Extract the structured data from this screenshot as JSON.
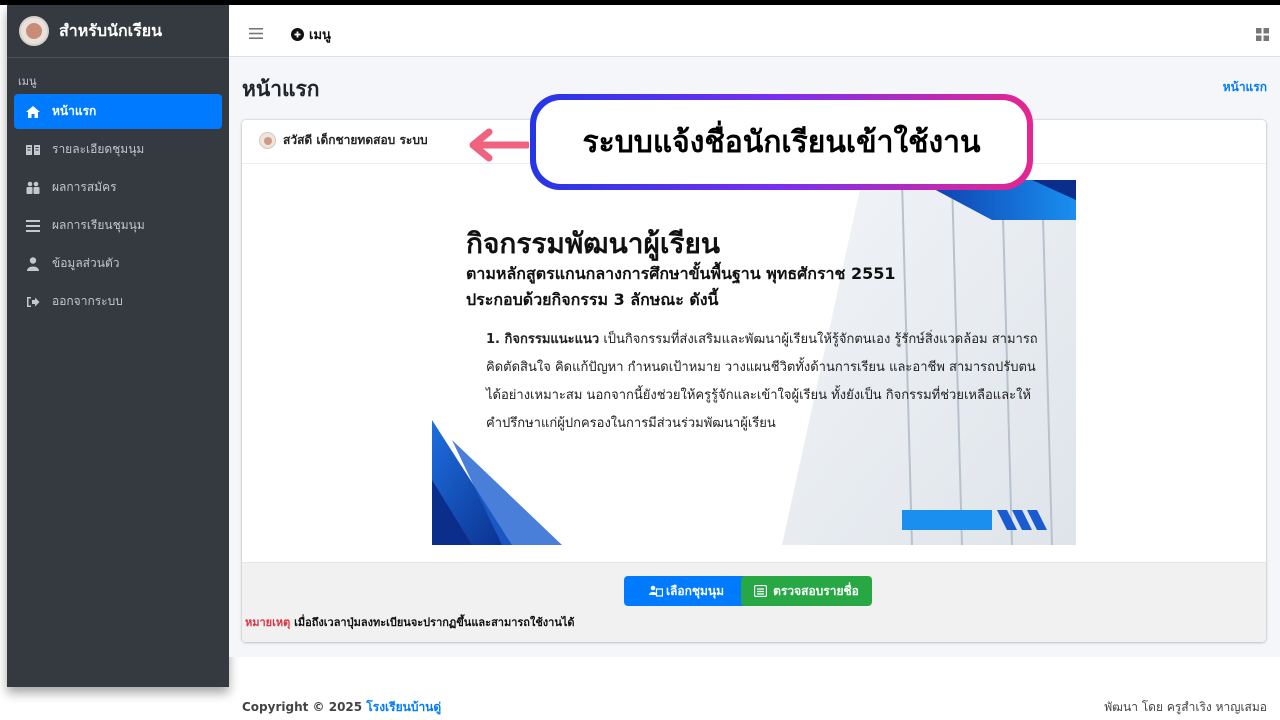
{
  "brand": {
    "title": "สำหรับนักเรียน"
  },
  "sidebar": {
    "header": "เมนู",
    "items": [
      {
        "label": "หน้าแรก",
        "icon": "home-icon",
        "active": true
      },
      {
        "label": "รายละเอียดชุมนุม",
        "icon": "book-open-icon",
        "active": false
      },
      {
        "label": "ผลการสมัคร",
        "icon": "users-icon",
        "active": false
      },
      {
        "label": "ผลการเรียนชุมนุม",
        "icon": "list-icon",
        "active": false
      },
      {
        "label": "ข้อมูลส่วนตัว",
        "icon": "user-icon",
        "active": false
      },
      {
        "label": "ออกจากระบบ",
        "icon": "sign-out-icon",
        "active": false
      }
    ]
  },
  "header": {
    "menu_label": "เมนู"
  },
  "content": {
    "page_title": "หน้าแรก",
    "breadcrumb": "หน้าแรก",
    "greeting": "สวัสดี เด็กชายทดสอบ ระบบ",
    "callout": "ระบบแจ้งชื่อนักเรียนเข้าใช้งาน",
    "banner": {
      "title": "กิจกรรมพัฒนาผู้เรียน",
      "subtitle1": "ตามหลักสูตรแกนกลางการศึกษาขั้นพื้นฐาน พุทธศักราช 2551",
      "subtitle2": "ประกอบด้วยกิจกรรม 3 ลักษณะ ดังนี้",
      "point_label": "1. กิจกรรมแนะแนว",
      "point_text": " เป็นกิจกรรมที่ส่งเสริมและพัฒนาผู้เรียนให้รู้จักตนเอง รู้รักษ์สิ่งแวดล้อม สามารถคิดตัดสินใจ คิดแก้ปัญหา กำหนดเป้าหมาย วางแผนชีวิตทั้งด้านการเรียน และอาชีพ สามารถปรับตนได้อย่างเหมาะสม นอกจากนี้ยังช่วยให้ครูรู้จักและเข้าใจผู้เรียน ทั้งยังเป็น กิจกรรมที่ช่วยเหลือและให้คำปรึกษาแก่ผู้ปกครองในการมีส่วนร่วมพัฒนาผู้เรียน"
    },
    "buttons": {
      "select_club": "เลือกชุมนุม",
      "check_list": "ตรวจสอบรายชื่อ"
    },
    "note_label": "หมายเหตุ",
    "note_text": " เมื่อถึงเวลาปุ่มลงทะเบียนจะปรากฏขึ้นและสามารถใช้งานได้"
  },
  "footer": {
    "copyright_prefix": "Copyright © 2025 ",
    "school": "โรงเรียนบ้านดู่",
    "credit": "พัฒนา โดย ครูสำเริง หาญเสมอ"
  },
  "colors": {
    "primary": "#007bff",
    "success": "#28a745",
    "sidebar": "#343a40",
    "danger": "#dc3545"
  }
}
